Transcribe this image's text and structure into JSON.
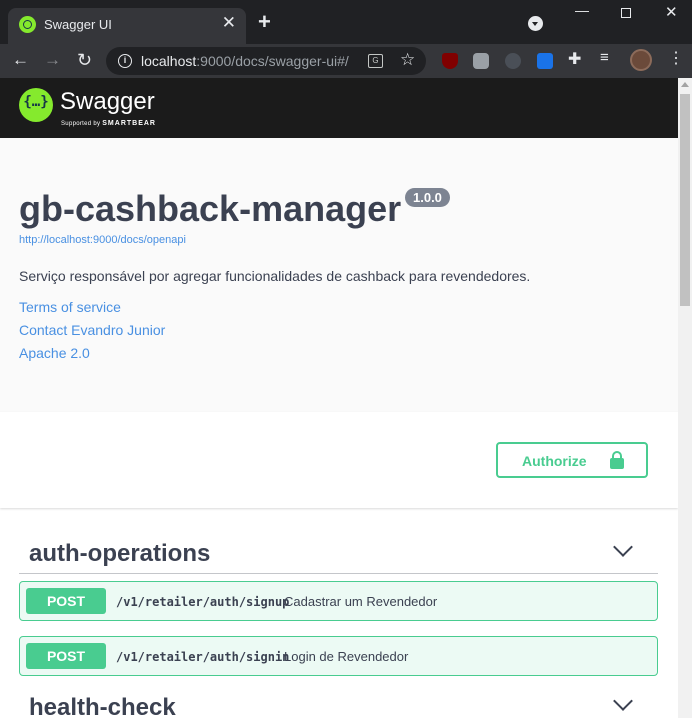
{
  "browser": {
    "tab_title": "Swagger UI",
    "tab_close": "✕",
    "new_tab": "+",
    "url_host": "localhost",
    "url_path": ":9000/docs/swagger-ui#/",
    "colors": {
      "frame": "#202124",
      "toolbar": "#35363a"
    }
  },
  "swagger": {
    "brand_name": "Swagger",
    "brand_sub_prefix": "Supported by",
    "brand_sub_company": "SMARTBEAR",
    "logo_glyph": "{…}"
  },
  "info": {
    "title": "gb-cashback-manager",
    "version": "1.0.0",
    "spec_url": "http://localhost:9000/docs/openapi",
    "description": "Serviço responsável por agregar funcionalidades de cashback para revendedores.",
    "terms_label": "Terms of service",
    "contact_label": "Contact Evandro Junior",
    "license_label": "Apache 2.0"
  },
  "authorize": {
    "label": "Authorize"
  },
  "tags": [
    {
      "name": "auth-operations",
      "operations": [
        {
          "method": "POST",
          "path": "/v1/retailer/auth/signup",
          "summary": "Cadastrar um Revendedor"
        },
        {
          "method": "POST",
          "path": "/v1/retailer/auth/signin",
          "summary": "Login de Revendedor"
        }
      ]
    },
    {
      "name": "health-check",
      "operations": []
    }
  ],
  "colors": {
    "accent_green": "#49cc90",
    "link_blue": "#4990e2",
    "text": "#3b4151"
  }
}
